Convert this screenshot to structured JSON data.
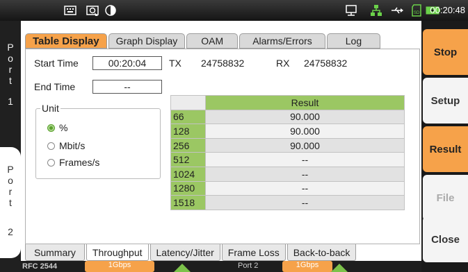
{
  "statusbar": {
    "icons": [
      "keyboard-icon",
      "screenshot-icon",
      "contrast-icon",
      "monitor-icon",
      "network-icon",
      "usb-icon",
      "sd-card-icon",
      "battery-icon"
    ],
    "time": "00:20:48"
  },
  "ports": [
    {
      "letters": [
        "P",
        "o",
        "r",
        "t"
      ],
      "number": "1"
    },
    {
      "letters": [
        "P",
        "o",
        "r",
        "t"
      ],
      "number": "2"
    }
  ],
  "tabs": [
    "Table Display",
    "Graph Display",
    "OAM",
    "Alarms/Errors",
    "Log"
  ],
  "active_tab": "Table Display",
  "times": {
    "start_label": "Start Time",
    "start_value": "00:20:04",
    "end_label": "End Time",
    "end_value": "--"
  },
  "counters": {
    "tx_label": "TX",
    "tx_value": "24758832",
    "rx_label": "RX",
    "rx_value": "24758832"
  },
  "unit": {
    "legend": "Unit",
    "options": [
      "%",
      "Mbit/s",
      "Frames/s"
    ],
    "selected": "%"
  },
  "table": {
    "header": "Result",
    "rows": [
      {
        "frame_size": "66",
        "result": "90.000"
      },
      {
        "frame_size": "128",
        "result": "90.000"
      },
      {
        "frame_size": "256",
        "result": "90.000"
      },
      {
        "frame_size": "512",
        "result": "--"
      },
      {
        "frame_size": "1024",
        "result": "--"
      },
      {
        "frame_size": "1280",
        "result": "--"
      },
      {
        "frame_size": "1518",
        "result": "--"
      }
    ]
  },
  "bottom_tabs": [
    "Summary",
    "Throughput",
    "Latency/Jitter",
    "Frame Loss",
    "Back-to-back"
  ],
  "active_bottom_tab": "Throughput",
  "statusline": {
    "left": "RFC 2544",
    "speed1": "1Gbps",
    "port2": "Port 2",
    "speed2": "1Gbps"
  },
  "side_buttons": [
    {
      "label": "Stop",
      "style": "orange"
    },
    {
      "label": "Setup",
      "style": "white"
    },
    {
      "label": "Result",
      "style": "orange"
    },
    {
      "label": "File",
      "style": "disabled"
    },
    {
      "label": "Close",
      "style": "white"
    }
  ],
  "colors": {
    "accent": "#f6a24a",
    "table_green": "#9bc763",
    "radio_green": "#5aa02c"
  }
}
